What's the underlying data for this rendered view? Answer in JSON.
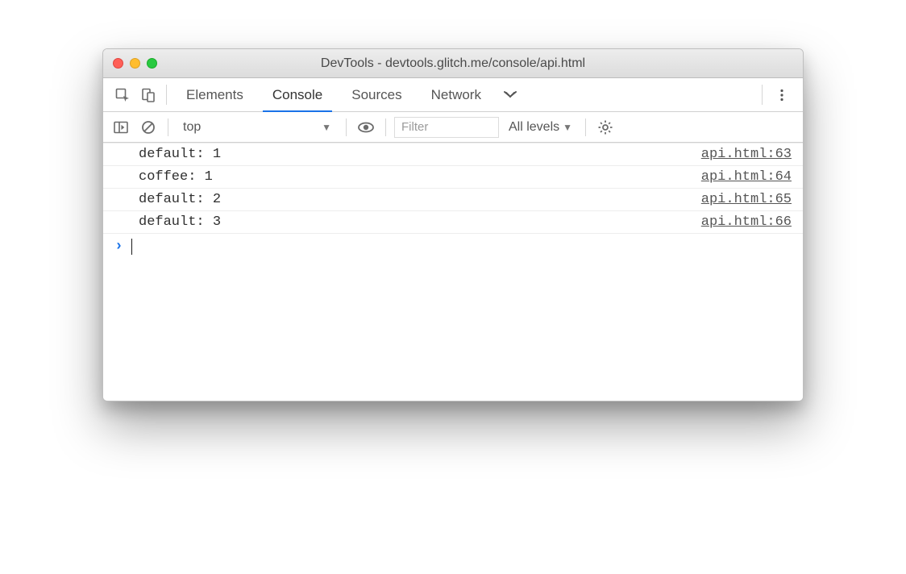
{
  "window": {
    "title": "DevTools - devtools.glitch.me/console/api.html"
  },
  "tabs": {
    "items": [
      "Elements",
      "Console",
      "Sources",
      "Network"
    ],
    "active_index": 1
  },
  "toolbar": {
    "context": "top",
    "filter_placeholder": "Filter",
    "levels_label": "All levels"
  },
  "console": {
    "logs": [
      {
        "text": "default: 1",
        "source": "api.html:63"
      },
      {
        "text": "coffee: 1",
        "source": "api.html:64"
      },
      {
        "text": "default: 2",
        "source": "api.html:65"
      },
      {
        "text": "default: 3",
        "source": "api.html:66"
      }
    ]
  }
}
